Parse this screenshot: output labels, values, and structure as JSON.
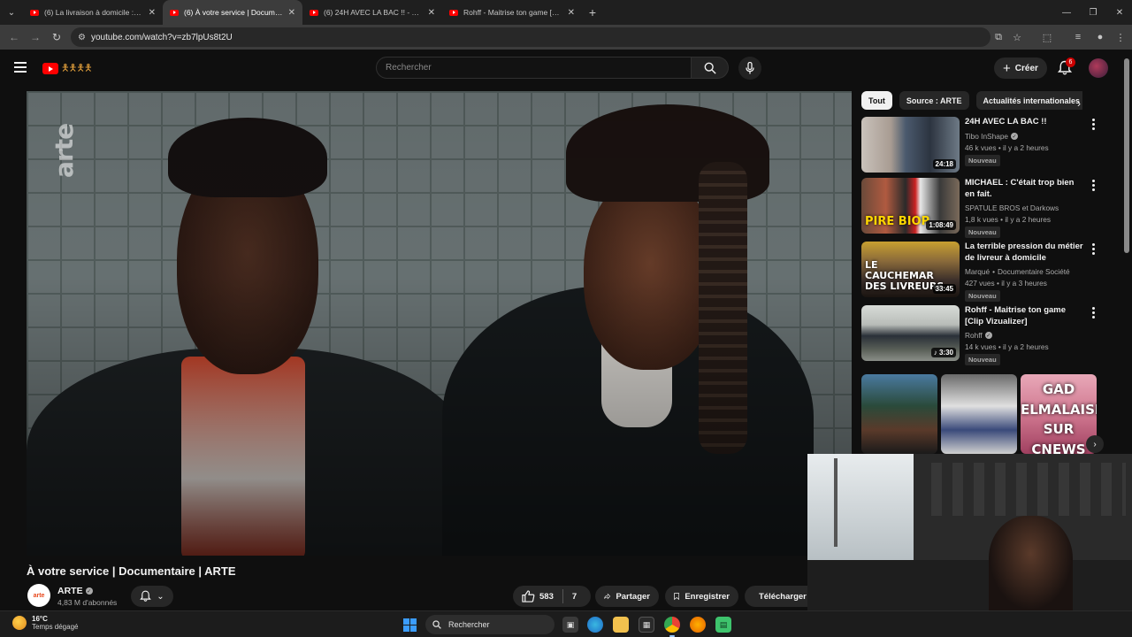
{
  "browser": {
    "tabs": [
      {
        "title": "(6) La livraison à domicile : de l'",
        "active": false
      },
      {
        "title": "(6) À votre service | Documenta",
        "active": true
      },
      {
        "title": "(6) 24H AVEC LA BAC !! - YouTu",
        "active": false
      },
      {
        "title": "Rohff - Maitrise ton game [Clip",
        "active": false
      }
    ],
    "url": "youtube.com/watch?v=zb7lpUs8t2U"
  },
  "header": {
    "search_placeholder": "Rechercher",
    "create_label": "Créer",
    "notification_count": "6"
  },
  "video": {
    "title": "À votre service | Documentaire | ARTE",
    "watermark": "arte",
    "channel_name": "ARTE",
    "channel_avatar_text": "arte",
    "subscribers": "4,83 M d'abonnés",
    "likes": "583",
    "dislikes": "7",
    "share_label": "Partager",
    "save_label": "Enregistrer",
    "download_label": "Télécharger"
  },
  "sidebar": {
    "chips": [
      "Tout",
      "Source : ARTE",
      "Actualités internationales"
    ],
    "recommendations": [
      {
        "title": "24H AVEC LA BAC !!",
        "channel": "Tibo InShape",
        "verified": true,
        "views": "46 k vues",
        "age": "il y a 2 heures",
        "badge": "Nouveau",
        "duration": "24:18",
        "thumb_text": ""
      },
      {
        "title": "MICHAEL : C'était trop bien en fait.",
        "channel": "SPATULE BROS et Darkows",
        "verified": false,
        "views": "1,8 k vues",
        "age": "il y a 2 heures",
        "badge": "Nouveau",
        "duration": "1:08:49",
        "thumb_text": "PIRE BIOP"
      },
      {
        "title": "La terrible pression du métier de livreur à domicile",
        "channel": "Marqué",
        "channel_extra": "Documentaire Société",
        "verified": false,
        "views": "427 vues",
        "age": "il y a 3 heures",
        "badge": "Nouveau",
        "duration": "33:45",
        "thumb_text": "LE CAUCHEMAR DES LIVREURS"
      },
      {
        "title": "Rohff - Maitrise ton game [Clip Vizualizer]",
        "channel": "Rohff",
        "verified": true,
        "views": "14 k vues",
        "age": "il y a 2 heures",
        "badge": "Nouveau",
        "duration": "3:30",
        "thumb_text": ""
      }
    ],
    "shorts": [
      {
        "text": ""
      },
      {
        "text": ""
      },
      {
        "text": "GAD ELMALAISE SUR CNEWS"
      }
    ]
  },
  "taskbar": {
    "temperature": "16°C",
    "weather": "Temps dégagé",
    "search_label": "Rechercher"
  }
}
